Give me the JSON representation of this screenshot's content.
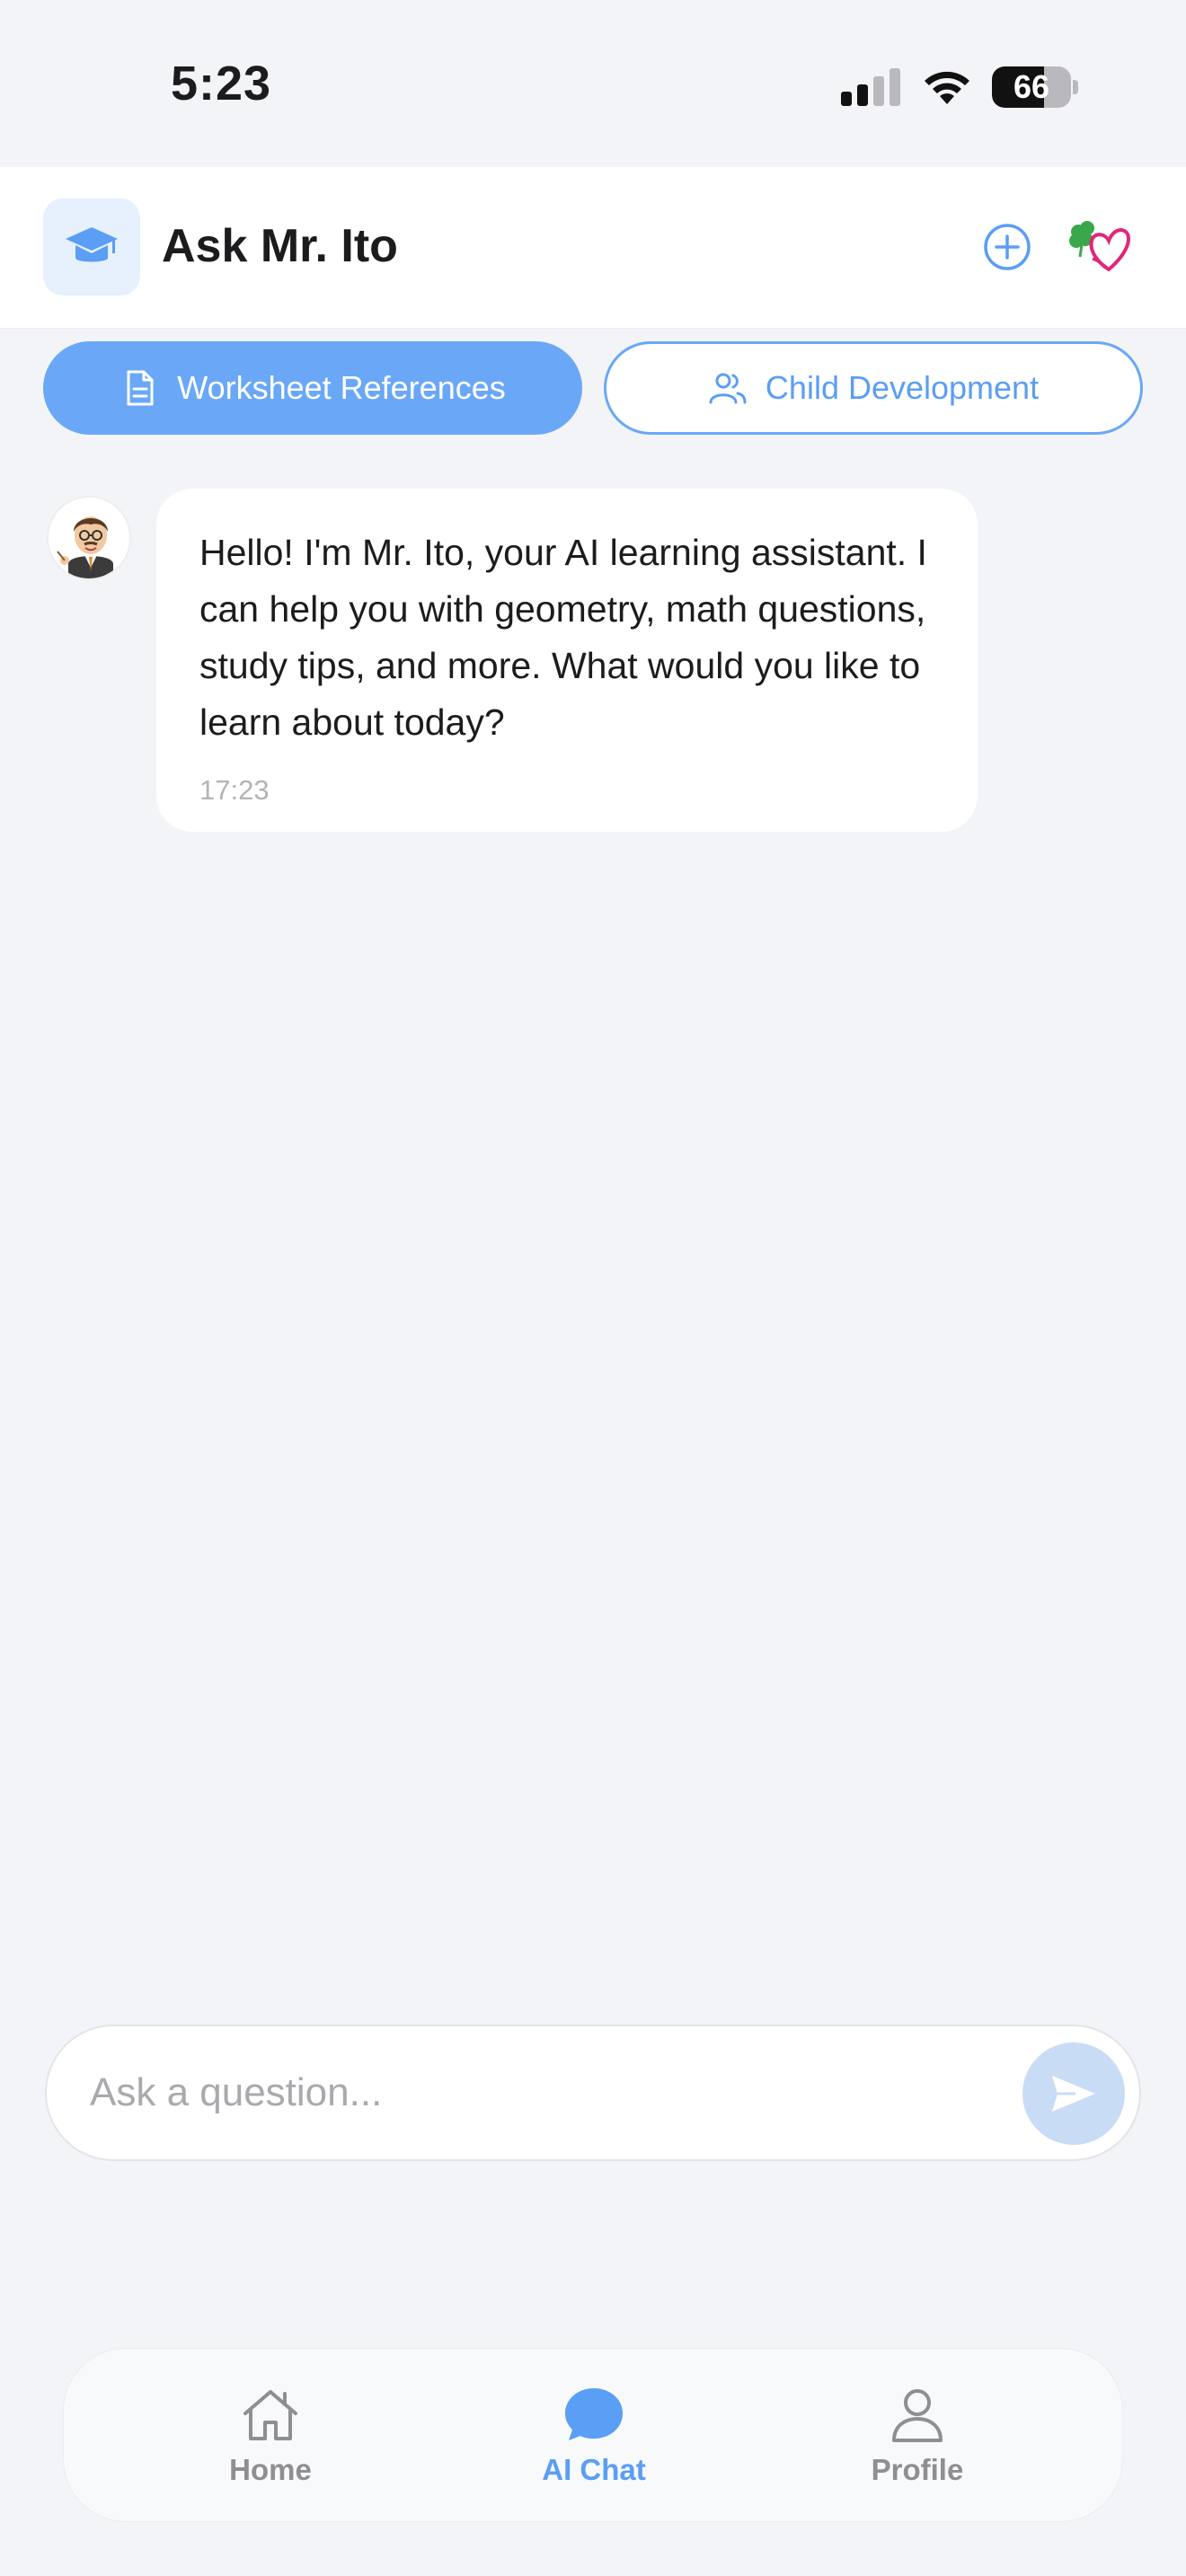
{
  "status_bar": {
    "time": "5:23",
    "battery": "66",
    "battery_level": 0.66
  },
  "header": {
    "title": "Ask Mr. Ito",
    "logo_icon": "graduation-cap-icon",
    "add_icon": "plus-circle-icon",
    "brand_icon": "clover-heart-logo"
  },
  "tabs": [
    {
      "label": "Worksheet References",
      "icon": "document-icon",
      "active": true
    },
    {
      "label": "Child Development",
      "icon": "users-icon",
      "active": false
    }
  ],
  "messages": [
    {
      "sender": "Mr. Ito",
      "text": "Hello! I'm Mr. Ito, your AI learning assistant. I can help you with geometry, math questions, study tips, and more. What would you like to learn about today?",
      "time": "17:23"
    }
  ],
  "input": {
    "placeholder": "Ask a question...",
    "value": ""
  },
  "nav": {
    "items": [
      {
        "label": "Home",
        "icon": "home-icon",
        "active": false
      },
      {
        "label": "AI Chat",
        "icon": "chat-bubble-icon",
        "active": true
      },
      {
        "label": "Profile",
        "icon": "person-icon",
        "active": false
      }
    ]
  },
  "colors": {
    "accent": "#6aa8f7",
    "background": "#f3f4f8",
    "send_button": "#c9dcf6"
  }
}
